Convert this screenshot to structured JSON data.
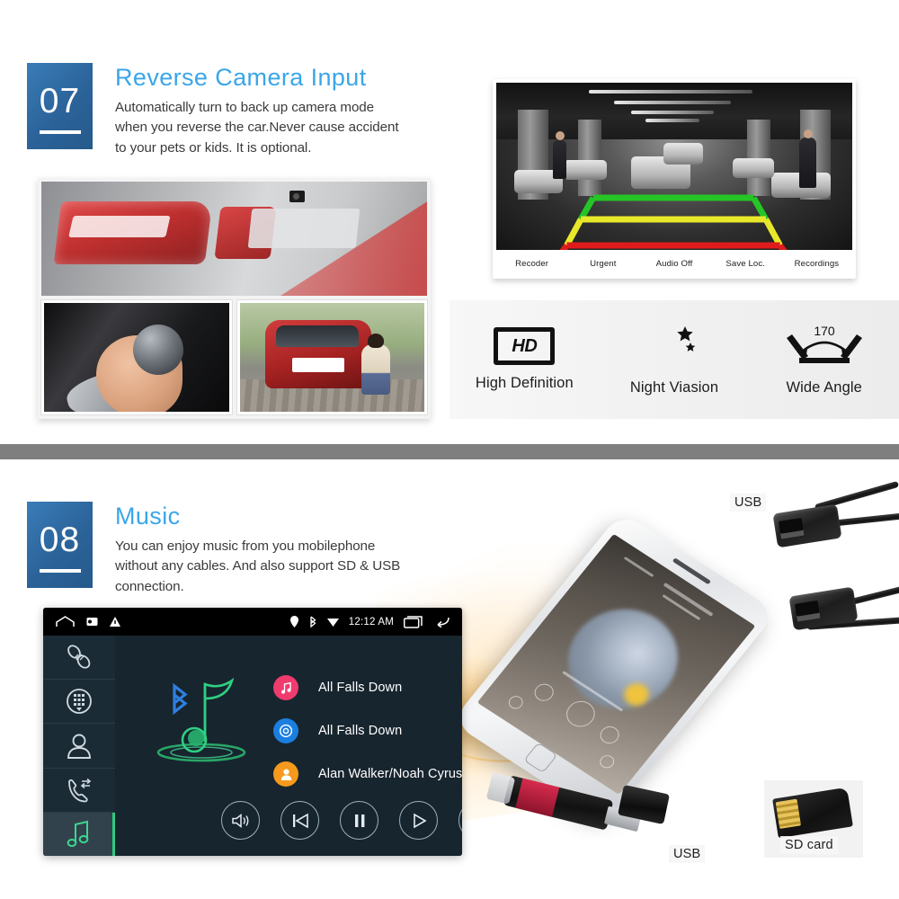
{
  "sections": [
    {
      "number": "07",
      "title": "Reverse Camera Input",
      "body": "Automatically turn to back up camera mode when you reverse the car.Never cause accident to your pets or kids. It is optional.",
      "camera_toolbar": [
        "Recoder",
        "Urgent",
        "Audio Off",
        "Save Loc.",
        "Recordings"
      ],
      "features": [
        {
          "icon": "hd-icon",
          "label": "High Definition",
          "badge": "HD"
        },
        {
          "icon": "moon-star-icon",
          "label": "Night Viasion"
        },
        {
          "icon": "wide-angle-icon",
          "label": "Wide Angle",
          "angle": "170"
        }
      ]
    },
    {
      "number": "08",
      "title": "Music",
      "body": "You can enjoy music from you mobilephone without any cables. And also support SD & USB connection.",
      "head_unit": {
        "status_bar": {
          "clock": "12:12 AM",
          "left_icons": [
            "home-icon",
            "screenshot-icon",
            "warning-icon"
          ],
          "right_icons": [
            "location-icon",
            "bluetooth-icon",
            "wifi-icon",
            "recents-icon",
            "back-icon"
          ]
        },
        "sidebar": [
          {
            "icon": "bluetooth-link-icon",
            "name": "pair",
            "active": false
          },
          {
            "icon": "dialpad-icon",
            "name": "dialpad",
            "active": false
          },
          {
            "icon": "contacts-icon",
            "name": "contacts",
            "active": false
          },
          {
            "icon": "call-history-icon",
            "name": "call-history",
            "active": false
          },
          {
            "icon": "music-note-icon",
            "name": "music",
            "active": true
          }
        ],
        "tracks": [
          {
            "icon": "music-note-icon",
            "color": "#ef3b6e",
            "text": "All Falls Down"
          },
          {
            "icon": "album-icon",
            "color": "#1b7fe0",
            "text": "All Falls Down"
          },
          {
            "icon": "artist-icon",
            "color": "#f59a1c",
            "text": "Alan Walker/Noah Cyrus..."
          }
        ],
        "controls": [
          {
            "icon": "volume-icon",
            "name": "volume"
          },
          {
            "icon": "previous-icon",
            "name": "previous"
          },
          {
            "icon": "pause-icon",
            "name": "pause"
          },
          {
            "icon": "play-icon",
            "name": "play"
          },
          {
            "icon": "next-icon",
            "name": "next"
          }
        ]
      },
      "product_labels": [
        {
          "text": "USB",
          "name": "usb-cable-label"
        },
        {
          "text": "USB",
          "name": "usb-drive-label"
        },
        {
          "text": "SD card",
          "name": "sd-card-label"
        }
      ]
    }
  ],
  "colors": {
    "badge_blue": "#2b6399",
    "title_blue": "#3aa6e8",
    "divider_gray": "#7f7f7f",
    "accent_green": "#2ecb7f",
    "guide_green": "#25c525",
    "guide_yellow": "#e8e82a",
    "guide_red": "#e01b1b"
  }
}
